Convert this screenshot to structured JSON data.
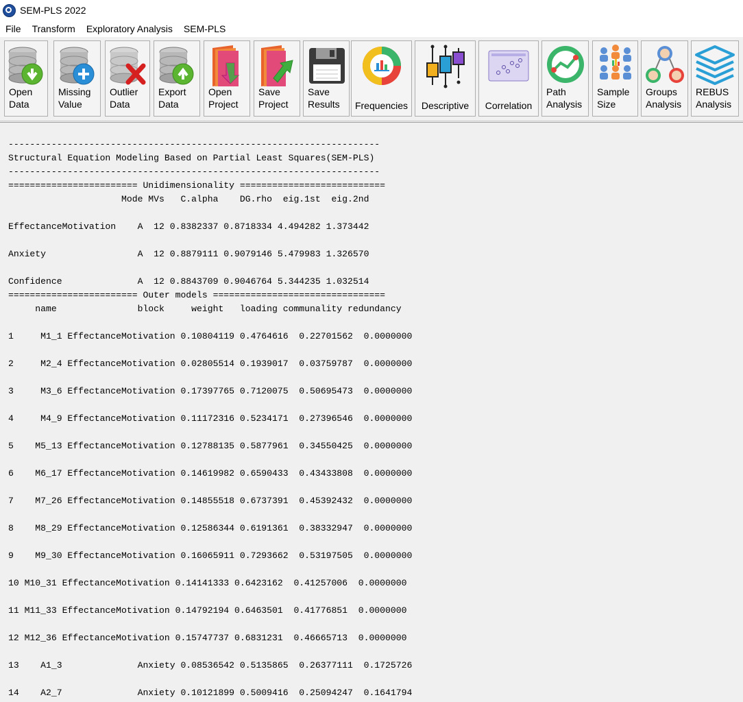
{
  "window": {
    "title": "SEM-PLS 2022"
  },
  "menu": [
    "File",
    "Transform",
    "Exploratory Analysis",
    "SEM-PLS"
  ],
  "toolbar": [
    {
      "label": "Open\nData",
      "icon": "db-download-icon"
    },
    {
      "label": "Missing\nValue",
      "icon": "db-plus-icon"
    },
    {
      "label": "Outlier\nData",
      "icon": "db-delete-icon"
    },
    {
      "label": "Export\nData",
      "icon": "db-upload-icon"
    },
    {
      "label": "Open\nProject",
      "icon": "open-book-icon"
    },
    {
      "label": "Save\nProject",
      "icon": "save-book-icon"
    },
    {
      "label": "Save\nResults",
      "icon": "floppy-disk-icon"
    },
    {
      "label": "Frequencies",
      "icon": "frequencies-chart-icon"
    },
    {
      "label": "Descriptive",
      "icon": "boxplot-icon"
    },
    {
      "label": "Correlation",
      "icon": "scatter-correlation-icon"
    },
    {
      "label": "Path\nAnalysis",
      "icon": "path-analysis-icon"
    },
    {
      "label": "Sample\nSize",
      "icon": "sample-size-icon"
    },
    {
      "label": "Groups\nAnalysis",
      "icon": "groups-analysis-icon"
    },
    {
      "label": "REBUS\nAnalysis",
      "icon": "rebus-layers-icon"
    }
  ],
  "output_lines": [
    "---------------------------------------------------------------------",
    "Structural Equation Modeling Based on Partial Least Squares(SEM-PLS)",
    "---------------------------------------------------------------------",
    "======================== Unidimensionality ===========================",
    "                     Mode MVs   C.alpha    DG.rho  eig.1st  eig.2nd",
    "",
    "EffectanceMotivation    A  12 0.8382337 0.8718334 4.494282 1.373442",
    "",
    "Anxiety                 A  12 0.8879111 0.9079146 5.479983 1.326570",
    "",
    "Confidence              A  12 0.8843709 0.9046764 5.344235 1.032514",
    "======================== Outer models ================================",
    "     name               block     weight   loading communality redundancy",
    "",
    "1     M1_1 EffectanceMotivation 0.10804119 0.4764616  0.22701562  0.0000000",
    "",
    "2     M2_4 EffectanceMotivation 0.02805514 0.1939017  0.03759787  0.0000000",
    "",
    "3     M3_6 EffectanceMotivation 0.17397765 0.7120075  0.50695473  0.0000000",
    "",
    "4     M4_9 EffectanceMotivation 0.11172316 0.5234171  0.27396546  0.0000000",
    "",
    "5    M5_13 EffectanceMotivation 0.12788135 0.5877961  0.34550425  0.0000000",
    "",
    "6    M6_17 EffectanceMotivation 0.14619982 0.6590433  0.43433808  0.0000000",
    "",
    "7    M7_26 EffectanceMotivation 0.14855518 0.6737391  0.45392432  0.0000000",
    "",
    "8    M8_29 EffectanceMotivation 0.12586344 0.6191361  0.38332947  0.0000000",
    "",
    "9    M9_30 EffectanceMotivation 0.16065911 0.7293662  0.53197505  0.0000000",
    "",
    "10 M10_31 EffectanceMotivation 0.14141333 0.6423162  0.41257006  0.0000000",
    "",
    "11 M11_33 EffectanceMotivation 0.14792194 0.6463501  0.41776851  0.0000000",
    "",
    "12 M12_36 EffectanceMotivation 0.15747737 0.6831231  0.46665713  0.0000000",
    "",
    "13    A1_3              Anxiety 0.08536542 0.5135865  0.26377111  0.1725726",
    "",
    "14    A2_7              Anxiety 0.10121899 0.5009416  0.25094247  0.1641794"
  ]
}
